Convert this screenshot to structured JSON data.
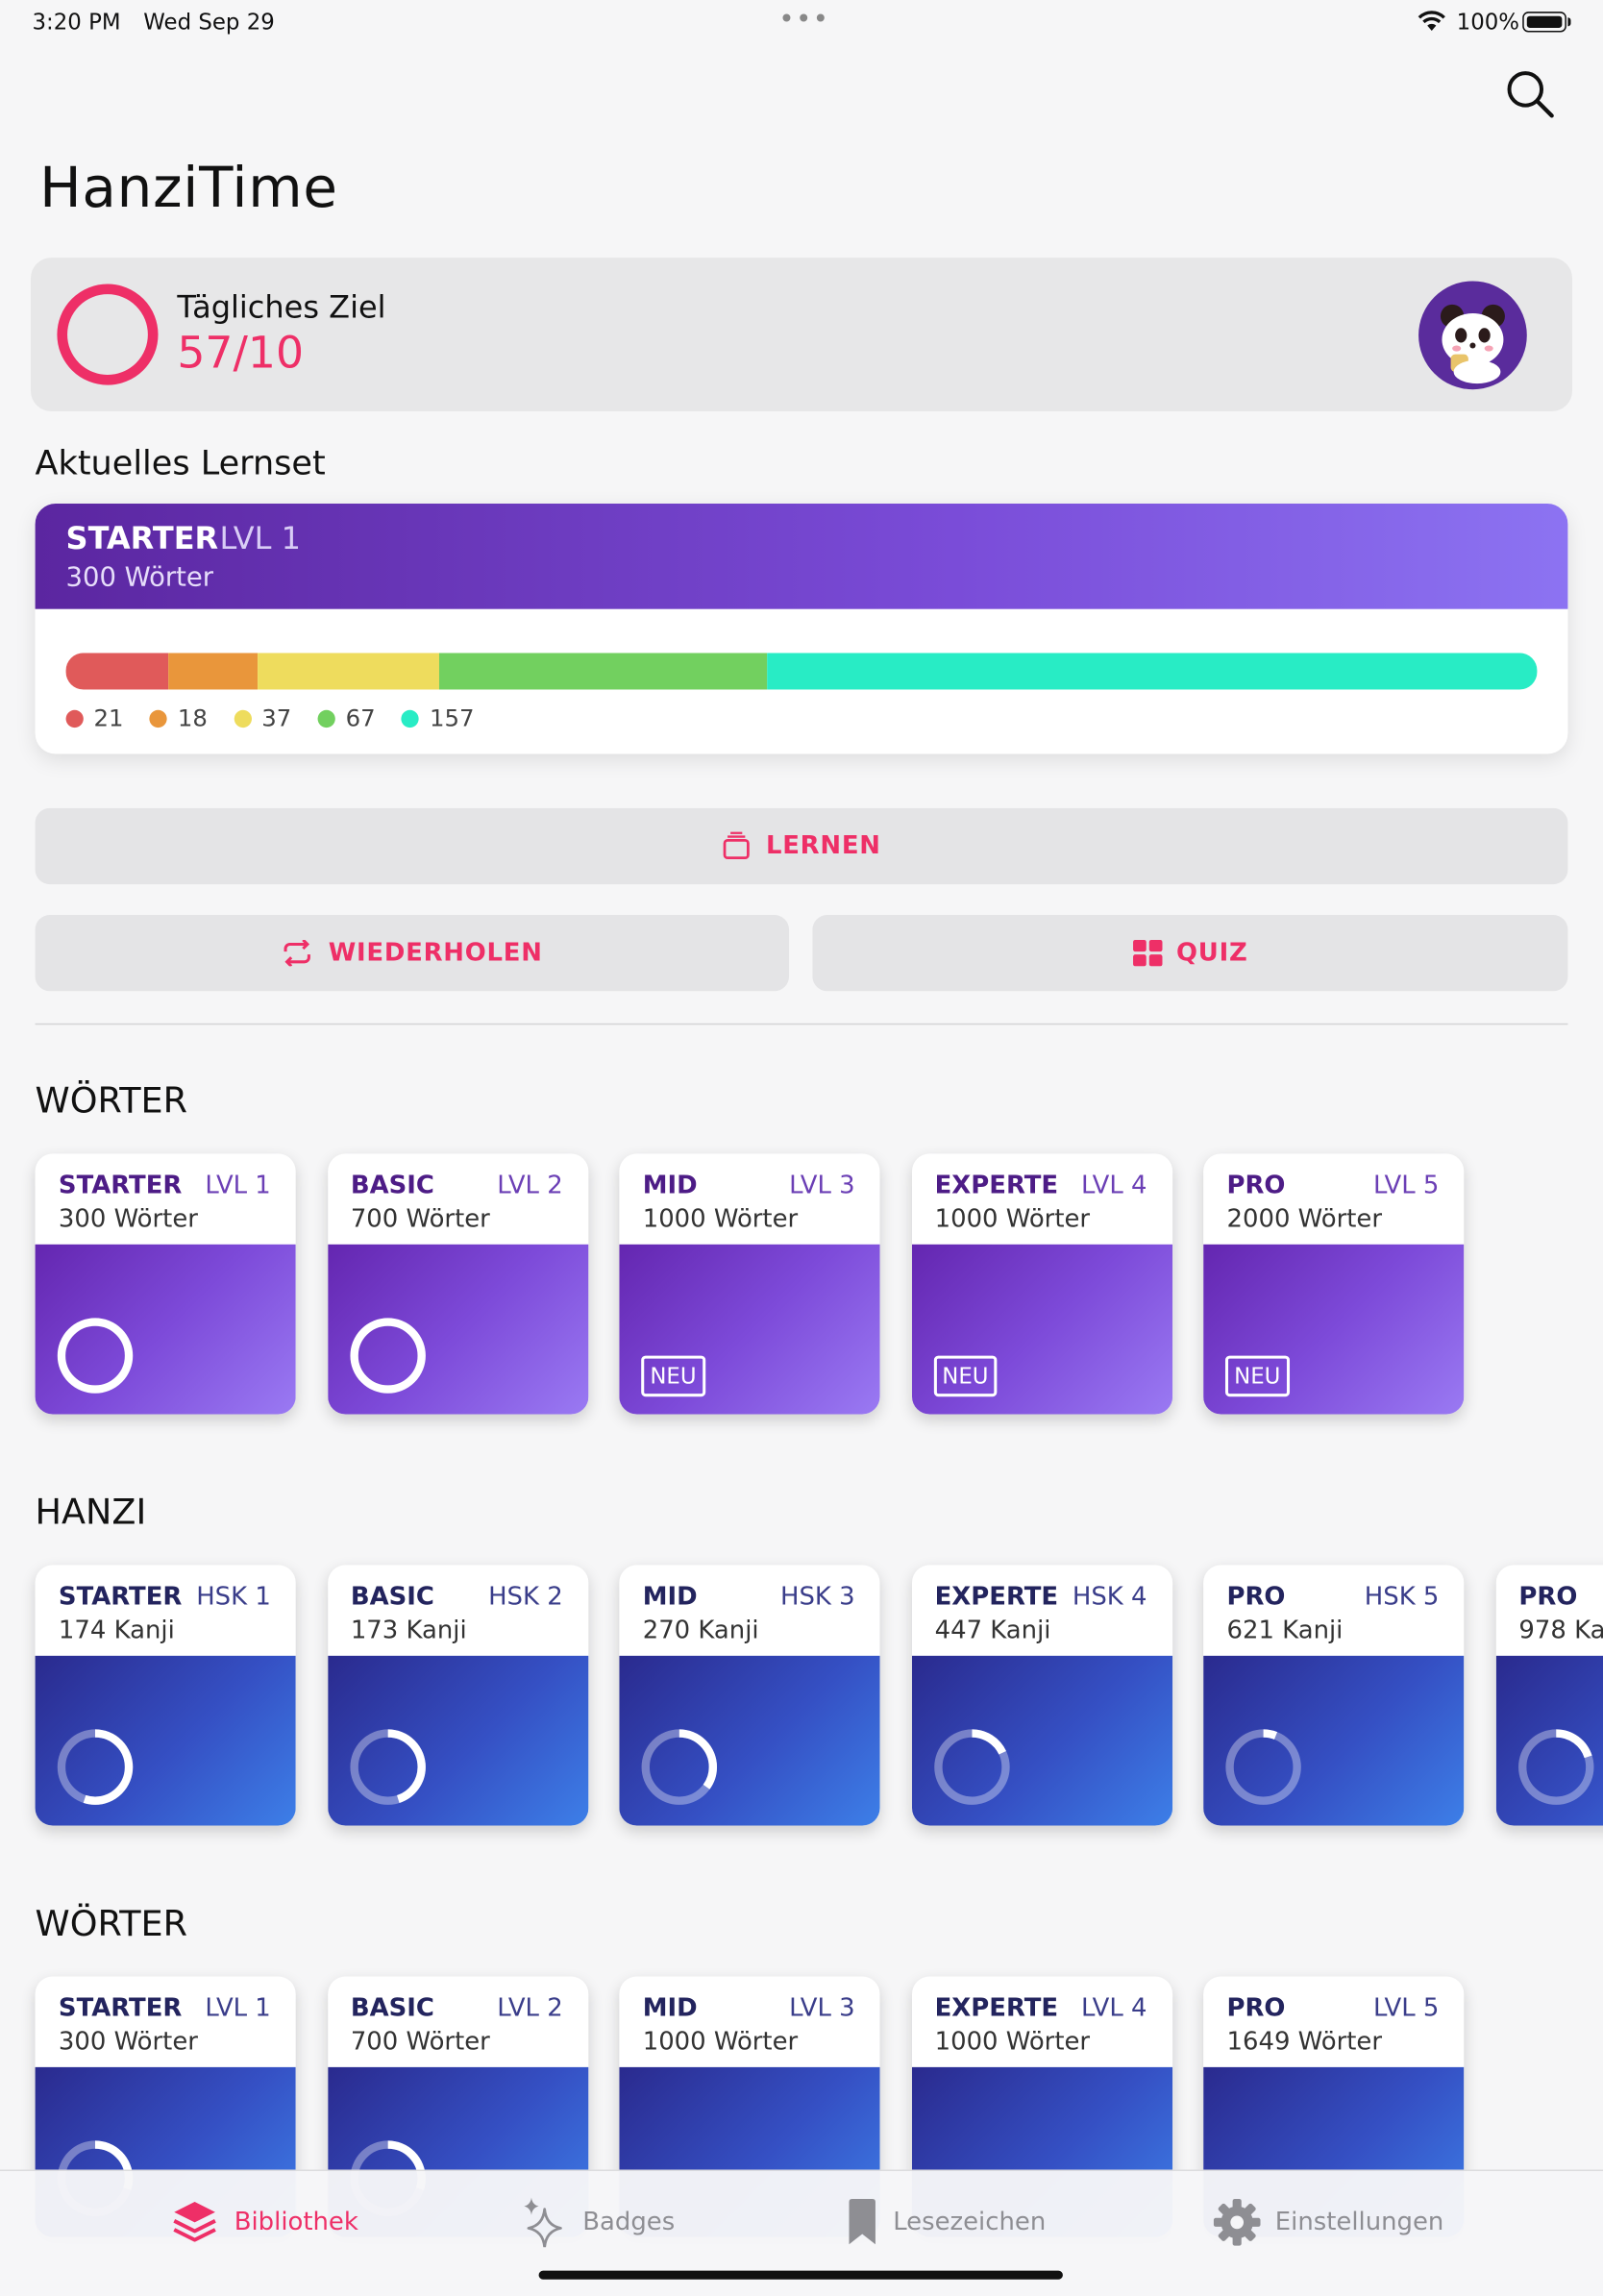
{
  "status": {
    "time": "3:20 PM",
    "date": "Wed Sep 29",
    "battery": "100%"
  },
  "app_title": "HanziTime",
  "goal": {
    "label": "Tägliches Ziel",
    "value": "57/10",
    "ring_color": "#ee2f67"
  },
  "current_set": {
    "section_label": "Aktuelles Lernset",
    "name": "STARTER",
    "level": "LVL 1",
    "count": "300 Wörter",
    "progress": [
      {
        "value": 21,
        "label": "21",
        "color": "#e05a5a"
      },
      {
        "value": 18,
        "label": "18",
        "color": "#e9963b"
      },
      {
        "value": 37,
        "label": "37",
        "color": "#eedc5d"
      },
      {
        "value": 67,
        "label": "67",
        "color": "#72d05f"
      },
      {
        "value": 157,
        "label": "157",
        "color": "#28ecc5"
      }
    ]
  },
  "buttons": {
    "learn": "LERNEN",
    "repeat": "WIEDERHOLEN",
    "quiz": "QUIZ"
  },
  "sections": [
    {
      "title": "WÖRTER",
      "style": "purple",
      "decks": [
        {
          "name": "STARTER",
          "level": "LVL 1",
          "count": "300 Wörter",
          "status": "ring",
          "progress": 0
        },
        {
          "name": "BASIC",
          "level": "LVL 2",
          "count": "700 Wörter",
          "status": "ring",
          "progress": 0
        },
        {
          "name": "MID",
          "level": "LVL 3",
          "count": "1000 Wörter",
          "status": "new",
          "badge": "NEU"
        },
        {
          "name": "EXPERTE",
          "level": "LVL 4",
          "count": "1000 Wörter",
          "status": "new",
          "badge": "NEU"
        },
        {
          "name": "PRO",
          "level": "LVL 5",
          "count": "2000 Wörter",
          "status": "new",
          "badge": "NEU"
        }
      ]
    },
    {
      "title": "HANZI",
      "style": "blue",
      "decks": [
        {
          "name": "STARTER",
          "level": "HSK 1",
          "count": "174 Kanji",
          "status": "ring",
          "progress": 0.55
        },
        {
          "name": "BASIC",
          "level": "HSK 2",
          "count": "173 Kanji",
          "status": "ring",
          "progress": 0.45
        },
        {
          "name": "MID",
          "level": "HSK 3",
          "count": "270 Kanji",
          "status": "ring",
          "progress": 0.35
        },
        {
          "name": "EXPERTE",
          "level": "HSK 4",
          "count": "447 Kanji",
          "status": "ring",
          "progress": 0.18
        },
        {
          "name": "PRO",
          "level": "HSK 5",
          "count": "621 Kanji",
          "status": "ring",
          "progress": 0.06
        },
        {
          "name": "PRO",
          "level": "",
          "count": "978 Ka",
          "status": "ring",
          "progress": 0.2
        }
      ]
    },
    {
      "title": "WÖRTER",
      "style": "blue",
      "decks": [
        {
          "name": "STARTER",
          "level": "LVL 1",
          "count": "300 Wörter",
          "status": "ring",
          "progress": 0.3
        },
        {
          "name": "BASIC",
          "level": "LVL 2",
          "count": "700 Wörter",
          "status": "ring",
          "progress": 0.3
        },
        {
          "name": "MID",
          "level": "LVL 3",
          "count": "1000 Wörter",
          "status": "none"
        },
        {
          "name": "EXPERTE",
          "level": "LVL 4",
          "count": "1000 Wörter",
          "status": "none"
        },
        {
          "name": "PRO",
          "level": "LVL 5",
          "count": "1649 Wörter",
          "status": "none"
        }
      ]
    }
  ],
  "tabs": [
    {
      "label": "Bibliothek",
      "icon": "stack-icon",
      "active": true
    },
    {
      "label": "Badges",
      "icon": "sparkles-icon",
      "active": false
    },
    {
      "label": "Lesezeichen",
      "icon": "bookmark-icon",
      "active": false
    },
    {
      "label": "Einstellungen",
      "icon": "gear-icon",
      "active": false
    }
  ]
}
